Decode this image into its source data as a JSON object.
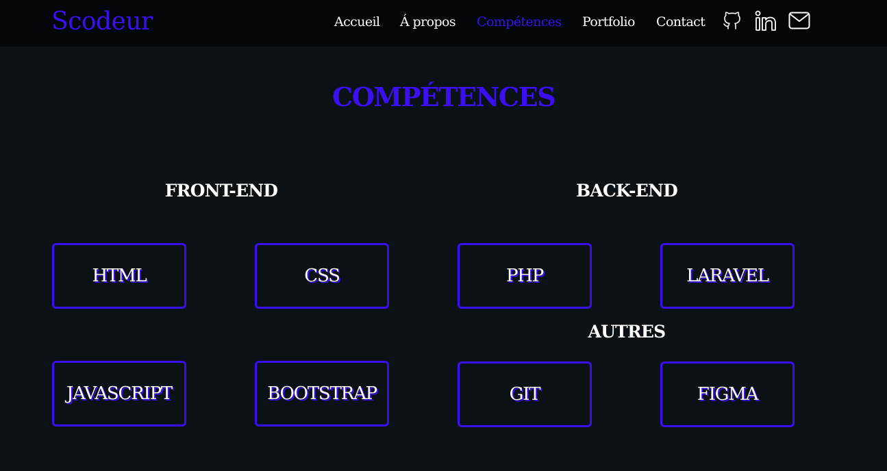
{
  "colors": {
    "accent": "#3a0ff0",
    "background": "#0b1114",
    "navbar": "#04070a",
    "text": "#ffffff"
  },
  "header": {
    "brand": "Scodeur",
    "nav": [
      {
        "label": "Accueil",
        "active": false
      },
      {
        "label": "Á propos",
        "active": false
      },
      {
        "label": "Compétences",
        "active": true
      },
      {
        "label": "Portfolio",
        "active": false
      },
      {
        "label": "Contact",
        "active": false
      }
    ],
    "social_icons": [
      "github-icon",
      "linkedin-icon",
      "mail-icon"
    ]
  },
  "skills": {
    "title": "COMPÉTENCES",
    "front_end": {
      "title": "FRONT-END",
      "items": [
        "HTML",
        "CSS",
        "JAVASCRIPT",
        "BOOTSTRAP"
      ]
    },
    "back_end": {
      "title": "BACK-END",
      "items": [
        "PHP",
        "LARAVEL"
      ]
    },
    "others": {
      "title": "AUTRES",
      "items": [
        "GIT",
        "FIGMA"
      ]
    }
  }
}
